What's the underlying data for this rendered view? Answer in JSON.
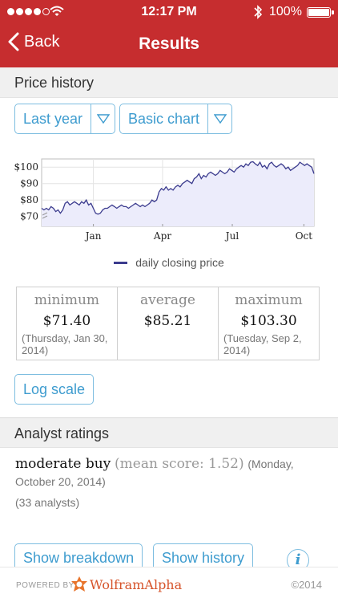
{
  "status_bar": {
    "time": "12:17 PM",
    "battery": "100%",
    "signal_bars": 4,
    "signal_total": 5
  },
  "nav": {
    "back_label": "Back",
    "title": "Results"
  },
  "price_history": {
    "header": "Price history",
    "range_select": "Last year",
    "chart_select": "Basic chart",
    "legend": "daily closing price",
    "stats": [
      {
        "label": "minimum",
        "value": "$71.40",
        "note": "(Thursday, Jan 30, 2014)"
      },
      {
        "label": "average",
        "value": "$85.21",
        "note": ""
      },
      {
        "label": "maximum",
        "value": "$103.30",
        "note": "(Tuesday, Sep 2, 2014)"
      }
    ],
    "log_scale_label": "Log scale"
  },
  "analyst": {
    "header": "Analyst ratings",
    "rating": "moderate buy",
    "mean": "(mean score: 1.52)",
    "date": "(Monday, October 20, 2014)",
    "count": "(33 analysts)",
    "show_breakdown": "Show breakdown",
    "show_history": "Show history"
  },
  "footer": {
    "powered_by": "POWERED BY",
    "brand": "WolframAlpha",
    "copyright": "©2014"
  },
  "colors": {
    "brand_red": "#c62d2f",
    "accent_blue": "#3e9ccf",
    "series": "#3b3b8e",
    "area_fill": "#ececfb"
  },
  "chart_data": {
    "type": "area",
    "series": [
      {
        "name": "daily closing price",
        "values": [
          75,
          74,
          75,
          74,
          76,
          75,
          73,
          74,
          72,
          74,
          78,
          79,
          77,
          78,
          79,
          78,
          77,
          79,
          78,
          80,
          77,
          78,
          75,
          72,
          71.4,
          72,
          74,
          75,
          75,
          76,
          77,
          76,
          75,
          76,
          77,
          76,
          76,
          75,
          76,
          77,
          78,
          77,
          76,
          77,
          76,
          77,
          78,
          80,
          79,
          80,
          85,
          87,
          86,
          88,
          86,
          87,
          86,
          88,
          89,
          88,
          90,
          91,
          92,
          91,
          90,
          93,
          94,
          96,
          93,
          95,
          94,
          96,
          97,
          96,
          95,
          96,
          98,
          97,
          96,
          97,
          99,
          98,
          97,
          99,
          100,
          101,
          100,
          102,
          101,
          103,
          103.3,
          102,
          101,
          103,
          100,
          101,
          99,
          102,
          103,
          101,
          100,
          101,
          102,
          101,
          99,
          100,
          98,
          99,
          100,
          101,
          103,
          102,
          101,
          102,
          101,
          100,
          96
        ]
      }
    ],
    "x_ticks": [
      "Jan",
      "Apr",
      "Jul",
      "Oct"
    ],
    "y_ticks": [
      "$100",
      "$90",
      "$80",
      "$70"
    ],
    "y_tick_values": [
      100,
      90,
      80,
      70
    ],
    "x_tick_fractions": [
      0.19,
      0.444,
      0.7,
      0.963
    ],
    "ylim": [
      64,
      105
    ],
    "grid": true
  }
}
